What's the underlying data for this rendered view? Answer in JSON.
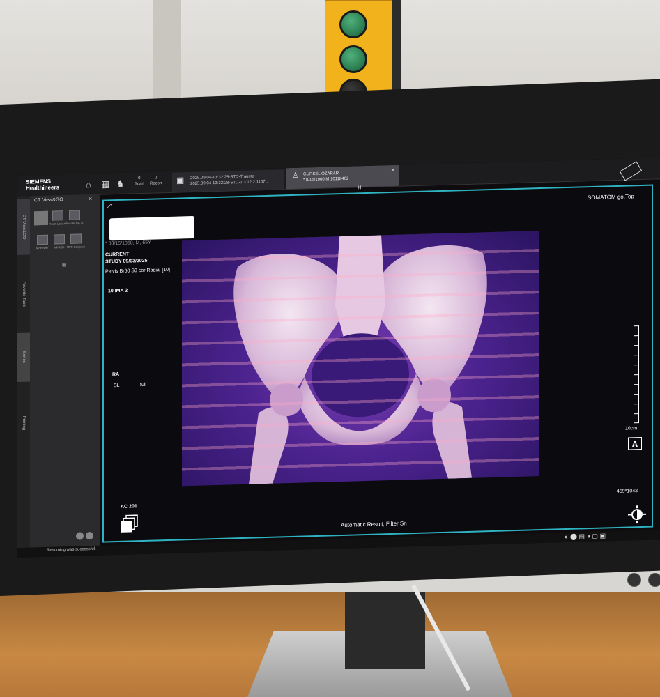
{
  "topbar": {
    "logo_line1": "SIEMENS",
    "logo_line2": "Healthineers",
    "scan_count": "0",
    "scan_label": "Scan",
    "recon_count": "0",
    "recon_label": "Recon",
    "tab1_line1": "2025.09.04-13:32:28-STD-Trauma",
    "tab1_line2": "2025.09.04-13:32:28-STD-1.3.12.2.1107...",
    "tab2_line1": "GURSEL OZARAR",
    "tab2_line2": "* 8/15/1960 M 10118462",
    "tab2_close": "×",
    "help": "?"
  },
  "leftpanel": {
    "title": "CT View&GO",
    "close": "×",
    "tools": [
      "Reset Layout",
      "Rotate Top/Bottom",
      "MPR/VRT",
      "MPR/3D",
      "MPR Compare"
    ],
    "tool_row1": [
      "Reset Layout",
      "Rotate Top 2D"
    ],
    "tool_row2": [
      "MPR/VRT",
      "MPR/3D",
      "MPR Compare"
    ],
    "vtabs": [
      "CT View&GO",
      "Favorite Tools",
      "Series",
      "Printing"
    ]
  },
  "viewport": {
    "orientation_marker": "H",
    "scanner": "SOMATOM go.Top",
    "patient_line": "* 08/15/1960, M, 65Y",
    "current": "CURRENT",
    "study": "STUDY 09/03/2025",
    "series": "Pelvis Br60 S3 cor Radial [10]",
    "image_num": "10 IMA 2",
    "orientation_ra": "RA",
    "sl_label": "SL",
    "sl_value": "full",
    "scale_label": "10cm",
    "matrix": "459*1043",
    "ac_label": "AC 201",
    "result_label": "Automatic Result, Filter Sn",
    "a_button": "A"
  },
  "statusbar": {
    "message": "Resuming was successful."
  },
  "colors": {
    "viewport_border": "#2fb3c0",
    "render_purple": "#5a2a9e",
    "bone": "#e8d8ee"
  }
}
